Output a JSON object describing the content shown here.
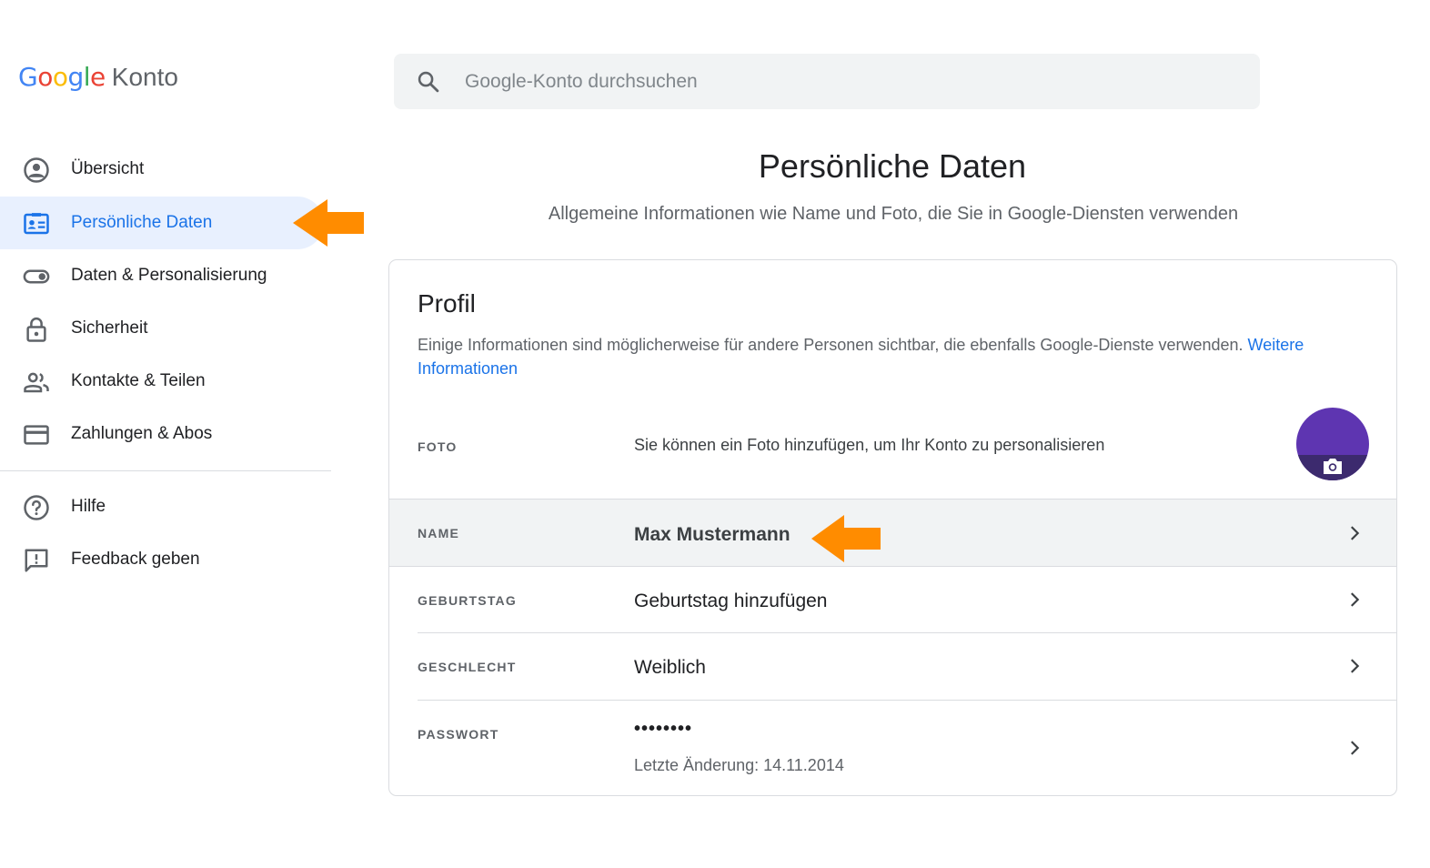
{
  "app": {
    "logo_google": "Google",
    "logo_konto": "Konto"
  },
  "search": {
    "placeholder": "Google-Konto durchsuchen",
    "value": ""
  },
  "sidebar": {
    "items": [
      {
        "label": "Übersicht",
        "icon": "account-circle-icon"
      },
      {
        "label": "Persönliche Daten",
        "icon": "id-card-icon",
        "active": true
      },
      {
        "label": "Daten & Personalisierung",
        "icon": "toggle-icon"
      },
      {
        "label": "Sicherheit",
        "icon": "lock-icon"
      },
      {
        "label": "Kontakte & Teilen",
        "icon": "people-icon"
      },
      {
        "label": "Zahlungen & Abos",
        "icon": "credit-card-icon"
      }
    ],
    "secondary": [
      {
        "label": "Hilfe",
        "icon": "help-icon"
      },
      {
        "label": "Feedback geben",
        "icon": "feedback-icon"
      }
    ]
  },
  "header": {
    "title": "Persönliche Daten",
    "subtitle": "Allgemeine Informationen wie Name und Foto, die Sie in Google-Diensten verwenden"
  },
  "profile": {
    "title": "Profil",
    "description": "Einige Informationen sind möglicherweise für andere Personen sichtbar, die ebenfalls Google-Dienste verwenden.",
    "link": "Weitere Informationen",
    "rows": {
      "photo": {
        "label": "FOTO",
        "value": "Sie können ein Foto hinzufügen, um Ihr Konto zu personalisieren"
      },
      "name": {
        "label": "NAME",
        "value": "Max Mustermann"
      },
      "birthday": {
        "label": "GEBURTSTAG",
        "value": "Geburtstag hinzufügen"
      },
      "gender": {
        "label": "GESCHLECHT",
        "value": "Weiblich"
      },
      "password": {
        "label": "PASSWORT",
        "value": "••••••••",
        "last_changed": "Letzte Änderung: 14.11.2014"
      }
    }
  },
  "colors": {
    "accent": "#1a73e8",
    "active_bg": "#e8f0fe",
    "annotation_arrow": "#ff8c00",
    "avatar": "#5e35b1"
  }
}
